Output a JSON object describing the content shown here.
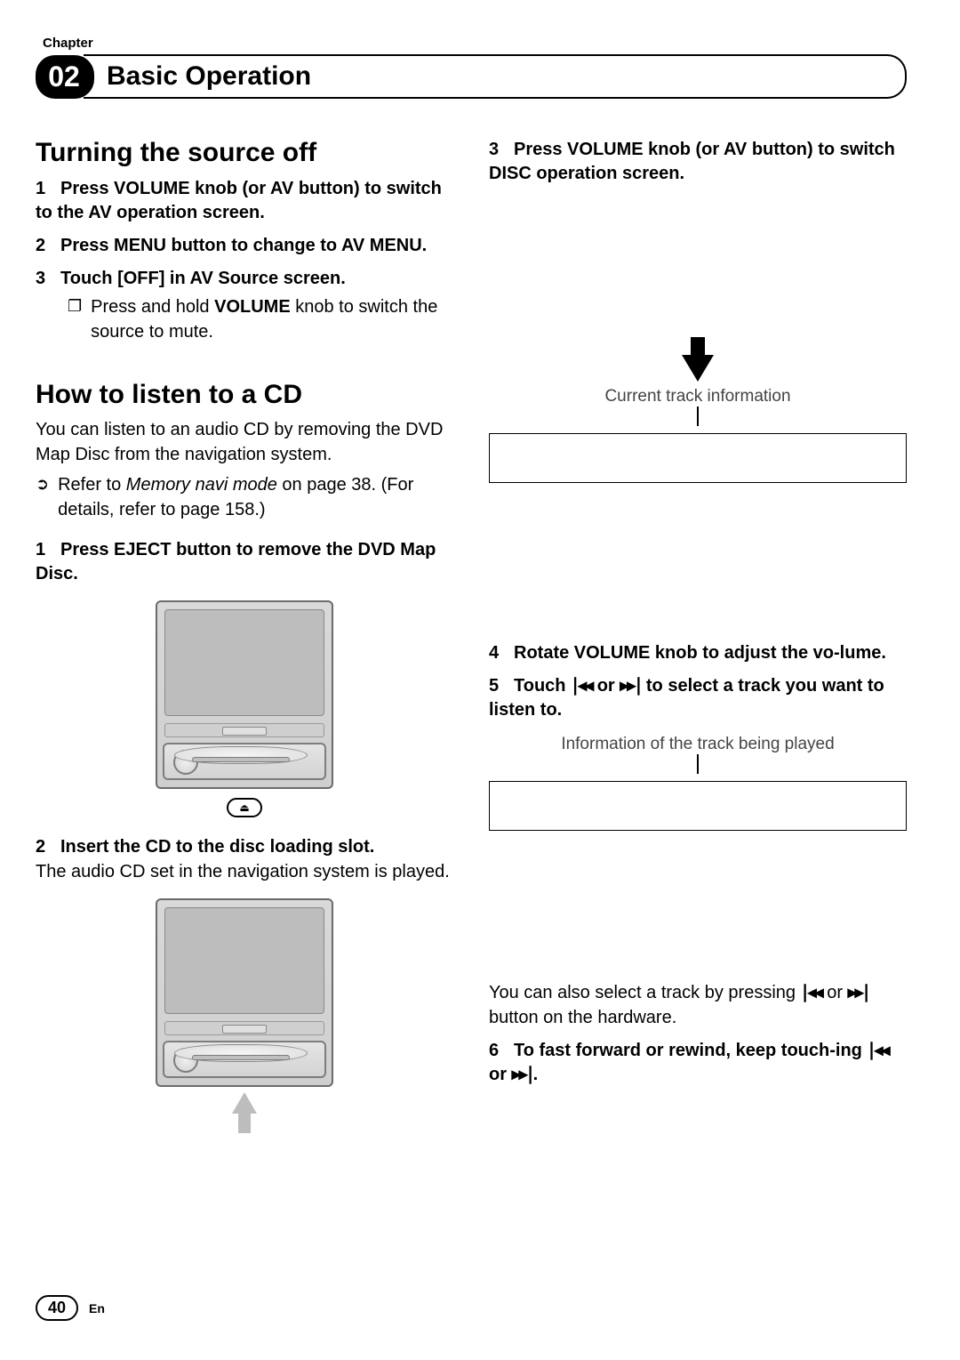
{
  "header": {
    "chapter_label": "Chapter",
    "chapter_number": "02",
    "title": "Basic Operation"
  },
  "left": {
    "section1_title": "Turning the source off",
    "s1_step1_num": "1",
    "s1_step1": "Press VOLUME knob (or AV button) to switch to the AV operation screen.",
    "s1_step2_num": "2",
    "s1_step2": "Press MENU button to change to AV MENU.",
    "s1_step3_num": "3",
    "s1_step3": "Touch [OFF] in AV Source screen.",
    "s1_note_icon": "❐",
    "s1_note_pre": "Press and hold ",
    "s1_note_bold": "VOLUME",
    "s1_note_post": " knob to switch the source to mute.",
    "section2_title": "How to listen to a CD",
    "s2_intro": "You can listen to an audio CD by removing the DVD Map Disc from the navigation system.",
    "s2_ref_icon": "➲",
    "s2_ref_pre": "Refer to ",
    "s2_ref_italic": "Memory navi mode",
    "s2_ref_post": " on page 38. (For details, refer to page 158.)",
    "s2_step1_num": "1",
    "s2_step1": "Press EJECT button to remove the DVD Map Disc.",
    "eject_glyph": "⏏",
    "s2_step2_num": "2",
    "s2_step2": "Insert the CD to the disc loading slot.",
    "s2_step2_body": "The audio CD set in the navigation system is played."
  },
  "right": {
    "step3_num": "3",
    "step3": "Press VOLUME knob (or AV button) to switch DISC operation screen.",
    "caption1": "Current track information",
    "step4_num": "4",
    "step4": "Rotate VOLUME knob to adjust the vo-lume.",
    "step5_num": "5",
    "step5_pre": "Touch ",
    "prev_icon": "∣◂◂",
    "or": " or ",
    "next_icon": "▸▸∣",
    "step5_post": " to select a track you want to listen to.",
    "caption2": "Information of the track being played",
    "also_pre": "You can also select a track by pressing ",
    "also_mid": " or ",
    "also_post": " button on the hardware.",
    "step6_num": "6",
    "step6_pre": "To fast forward or rewind, keep touch-ing ",
    "step6_mid": " or ",
    "step6_post": "."
  },
  "footer": {
    "page": "40",
    "lang": "En"
  }
}
